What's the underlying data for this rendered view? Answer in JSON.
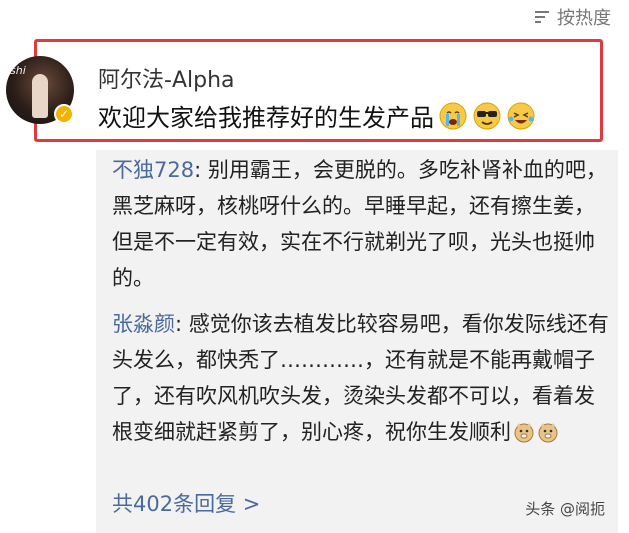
{
  "sort": {
    "label": "按热度",
    "icon": "sort-icon"
  },
  "post": {
    "username": "阿尔法-Alpha",
    "text": "欢迎大家给我推荐好的生发产品",
    "verified_icon": "verified-badge-icon",
    "emojis": [
      "crying-face-emoji",
      "cool-sunglasses-emoji",
      "laughing-tears-emoji"
    ],
    "highlight_color": "#e0393e"
  },
  "replies": [
    {
      "name": "不独728",
      "text": ": 别用霸王，会更脱的。多吃补肾补血的吧，黑芝麻呀，核桃呀什么的。早睡早起，还有擦生姜，但是不一定有效，实在不行就剃光了呗，光头也挺帅的。"
    },
    {
      "name": "张淼颜",
      "text": ": 感觉你该去植发比较容易吧，看你发际线还有头发么，都快秃了…………，还有就是不能再戴帽子了，还有吹风机吹头发，烫染头发都不可以，看着发根变细就赶紧剪了，别心疼，祝你生发顺利",
      "emojis": [
        "doge-emoji",
        "doge-emoji"
      ]
    }
  ],
  "more_replies": "共402条回复 >",
  "watermark": "头条 @阅扼",
  "colors": {
    "link": "#4a6b9a",
    "reply_bg": "#f2f2f2",
    "verified": "#f5b100"
  }
}
